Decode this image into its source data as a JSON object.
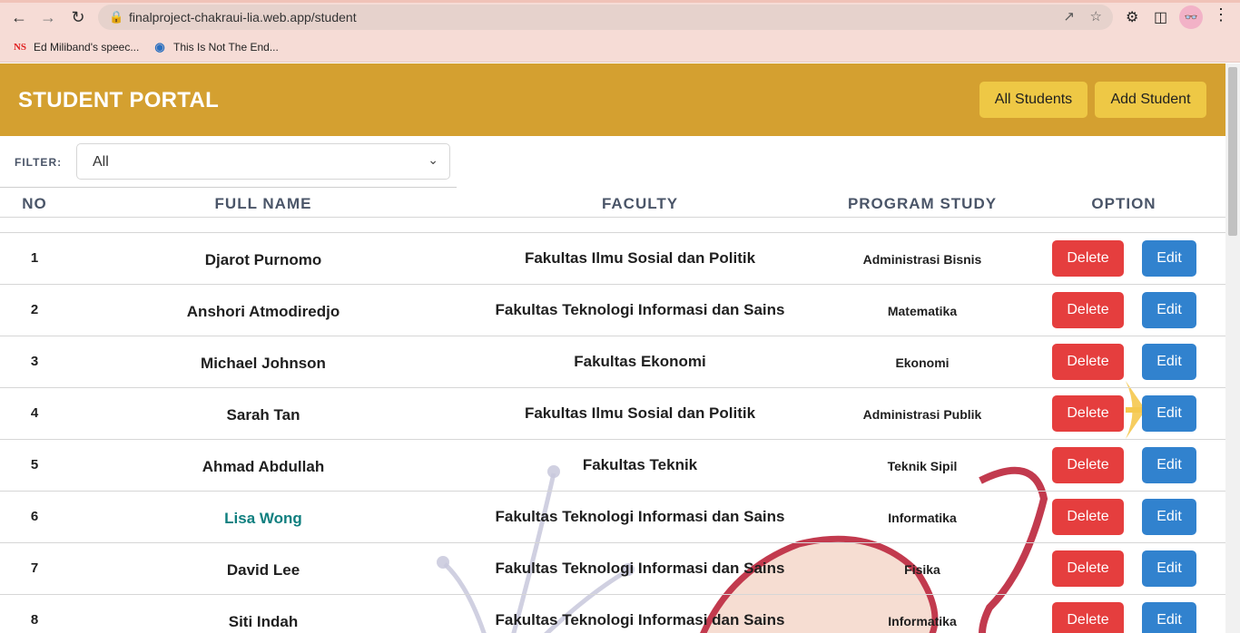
{
  "browser": {
    "url": "finalproject-chakraui-lia.web.app/student",
    "bookmarks": [
      {
        "icon": "NS",
        "label": "Ed Miliband's speec..."
      },
      {
        "icon": "blue-bookmark-icon",
        "label": "This Is Not The End..."
      }
    ]
  },
  "header": {
    "brand": "STUDENT PORTAL",
    "all_students": "All Students",
    "add_student": "Add Student",
    "accent": "#d4a030",
    "button_color": "#eec845"
  },
  "filter": {
    "label": "FILTER:",
    "value": "All"
  },
  "table": {
    "columns": [
      "NO",
      "FULL NAME",
      "FACULTY",
      "PROGRAM STUDY",
      "OPTION"
    ],
    "delete_label": "Delete",
    "edit_label": "Edit",
    "rows": [
      {
        "no": "1",
        "name": "Djarot Purnomo",
        "faculty": "Fakultas Ilmu Sosial dan Politik",
        "program": "Administrasi Bisnis"
      },
      {
        "no": "2",
        "name": "Anshori Atmodiredjo",
        "faculty": "Fakultas Teknologi Informasi dan Sains",
        "program": "Matematika"
      },
      {
        "no": "3",
        "name": "Michael Johnson",
        "faculty": "Fakultas Ekonomi",
        "program": "Ekonomi"
      },
      {
        "no": "4",
        "name": "Sarah Tan",
        "faculty": "Fakultas Ilmu Sosial dan Politik",
        "program": "Administrasi Publik"
      },
      {
        "no": "5",
        "name": "Ahmad Abdullah",
        "faculty": "Fakultas Teknik",
        "program": "Teknik Sipil"
      },
      {
        "no": "6",
        "name": "Lisa Wong",
        "faculty": "Fakultas Teknologi Informasi dan Sains",
        "program": "Informatika"
      },
      {
        "no": "7",
        "name": "David Lee",
        "faculty": "Fakultas Teknologi Informasi dan Sains",
        "program": "Fisika"
      },
      {
        "no": "8",
        "name": "Siti Indah",
        "faculty": "Fakultas Teknologi Informasi dan Sains",
        "program": "Informatika"
      }
    ],
    "delete_color": "#e53e3e",
    "edit_color": "#3182ce"
  }
}
